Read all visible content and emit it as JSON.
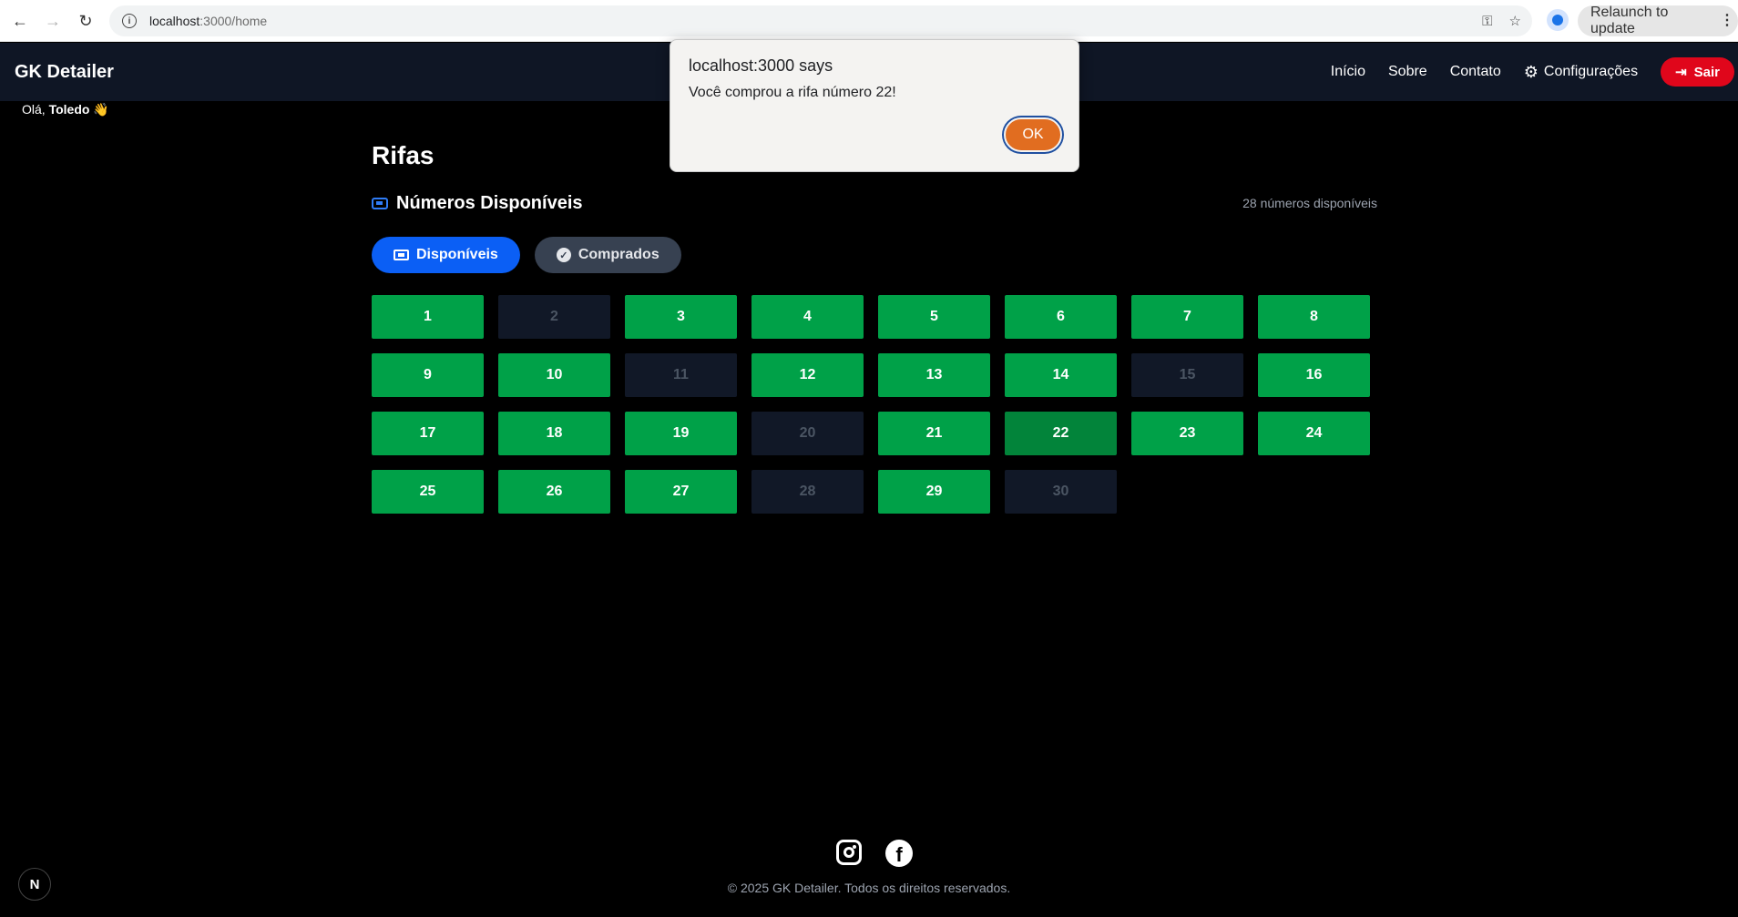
{
  "browser": {
    "url_host": "localhost",
    "url_path": ":3000/home",
    "relaunch_label": "Relaunch to update"
  },
  "header": {
    "brand": "GK Detailer",
    "nav": [
      "Início",
      "Sobre",
      "Contato",
      "Configurações"
    ],
    "logout_label": "Sair"
  },
  "greeting": {
    "prefix": "Olá,",
    "name": "Toledo",
    "emoji": "👋"
  },
  "main": {
    "title": "Rifas",
    "subtitle": "Números Disponíveis",
    "count": "28 números disponíveis",
    "filters": [
      "Disponíveis",
      "Comprados"
    ],
    "numbers": [
      {
        "n": "1",
        "status": "available"
      },
      {
        "n": "2",
        "status": "sold"
      },
      {
        "n": "3",
        "status": "available"
      },
      {
        "n": "4",
        "status": "available"
      },
      {
        "n": "5",
        "status": "available"
      },
      {
        "n": "6",
        "status": "available"
      },
      {
        "n": "7",
        "status": "available"
      },
      {
        "n": "8",
        "status": "available"
      },
      {
        "n": "9",
        "status": "available"
      },
      {
        "n": "10",
        "status": "available"
      },
      {
        "n": "11",
        "status": "sold"
      },
      {
        "n": "12",
        "status": "available"
      },
      {
        "n": "13",
        "status": "available"
      },
      {
        "n": "14",
        "status": "available"
      },
      {
        "n": "15",
        "status": "sold"
      },
      {
        "n": "16",
        "status": "available"
      },
      {
        "n": "17",
        "status": "available"
      },
      {
        "n": "18",
        "status": "available"
      },
      {
        "n": "19",
        "status": "available"
      },
      {
        "n": "20",
        "status": "sold"
      },
      {
        "n": "21",
        "status": "available"
      },
      {
        "n": "22",
        "status": "selected"
      },
      {
        "n": "23",
        "status": "available"
      },
      {
        "n": "24",
        "status": "available"
      },
      {
        "n": "25",
        "status": "available"
      },
      {
        "n": "26",
        "status": "available"
      },
      {
        "n": "27",
        "status": "available"
      },
      {
        "n": "28",
        "status": "sold"
      },
      {
        "n": "29",
        "status": "available"
      },
      {
        "n": "30",
        "status": "sold"
      }
    ]
  },
  "dialog": {
    "title": "localhost:3000 says",
    "message": "Você comprou a rifa número 22!",
    "ok_label": "OK"
  },
  "footer": {
    "copyright": "© 2025 GK Detailer. Todos os direitos reservados.",
    "next_badge": "N"
  },
  "colors": {
    "available": "#00a148",
    "sold": "#111827",
    "selected": "#02843a",
    "primary": "#0b5ff5",
    "danger": "#e0061b"
  }
}
